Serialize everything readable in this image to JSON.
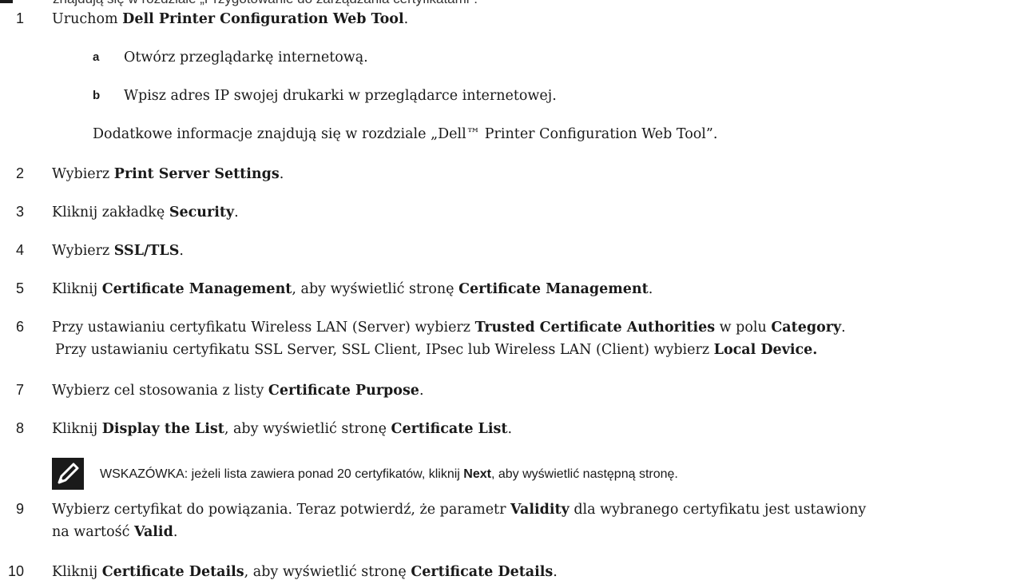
{
  "top_fragment": "znajdują się w rozdziale „Przygotowanie do zarządzania certyfikatami”.",
  "steps": [
    {
      "num": "1",
      "parts": [
        "Uruchom ",
        "Dell Printer Configuration Web Tool",
        "."
      ]
    },
    {
      "num": "2",
      "parts": [
        "Wybierz ",
        "Print Server Settings",
        "."
      ]
    },
    {
      "num": "3",
      "parts": [
        "Kliknij zakładkę ",
        "Security",
        "."
      ]
    },
    {
      "num": "4",
      "parts": [
        "Wybierz ",
        "SSL/TLS",
        "."
      ]
    },
    {
      "num": "5",
      "parts": [
        "Kliknij ",
        "Certificate Management",
        ", aby wyświetlić stronę ",
        "Certificate Management",
        "."
      ]
    },
    {
      "num": "6",
      "parts": [
        "Przy ustawianiu certyfikatu Wireless LAN (Server) wybierz ",
        "Trusted Certificate Authorities",
        " w polu ",
        "Category",
        "."
      ]
    },
    {
      "num": "7",
      "parts": [
        "Wybierz cel stosowania z listy ",
        "Certificate Purpose",
        "."
      ]
    },
    {
      "num": "8",
      "parts": [
        "Kliknij ",
        "Display the List",
        ", aby wyświetlić stronę ",
        "Certificate List",
        "."
      ]
    },
    {
      "num": "9",
      "parts": [
        "Wybierz certyfikat do powiązania. Teraz potwierdź, że parametr ",
        "Validity",
        " dla wybranego certyfikatu jest ustawiony"
      ]
    },
    {
      "num": "10",
      "parts": [
        "Kliknij ",
        "Certificate Details",
        ", aby wyświetlić stronę ",
        "Certificate Details",
        "."
      ]
    }
  ],
  "substeps": [
    {
      "letter": "a",
      "text": "Otwórz przeglądarkę internetową."
    },
    {
      "letter": "b",
      "text": "Wpisz adres IP swojej drukarki w przeglądarce internetowej."
    }
  ],
  "step1_info": "Dodatkowe informacje znajdują się w rozdziale „Dell™ Printer Configuration Web Tool”.",
  "step6_cont": [
    "Przy ustawianiu certyfikatu SSL Server, SSL Client, IPsec lub Wireless LAN (Client) wybierz ",
    "Local Device."
  ],
  "step9_cont": [
    "na wartość ",
    "Valid",
    "."
  ],
  "note": {
    "icon": "pencil-note-icon",
    "parts": [
      "WSKAZÓWKA: jeżeli lista zawiera ponad 20 certyfikatów, kliknij ",
      "Next",
      ", aby wyświetlić następną stronę."
    ]
  }
}
